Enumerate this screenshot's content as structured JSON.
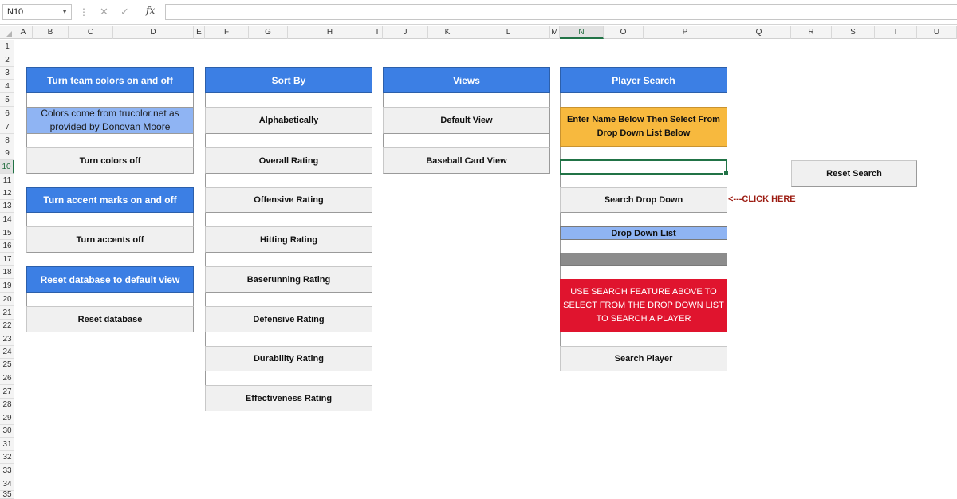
{
  "formula_bar": {
    "name_box": "N10",
    "cancel_icon": "cancel-x-icon",
    "enter_icon": "checkmark-icon",
    "fx_label": "fx",
    "formula": ""
  },
  "columns": [
    "A",
    "B",
    "C",
    "D",
    "E",
    "F",
    "G",
    "H",
    "I",
    "J",
    "K",
    "L",
    "M",
    "N",
    "O",
    "P",
    "Q",
    "R",
    "S",
    "T",
    "U"
  ],
  "selected_column": "N",
  "rows": [
    "1",
    "2",
    "3",
    "4",
    "5",
    "6",
    "7",
    "8",
    "9",
    "10",
    "11",
    "12",
    "13",
    "14",
    "15",
    "16",
    "17",
    "18",
    "19",
    "20",
    "21",
    "22",
    "23",
    "24",
    "25",
    "26",
    "27",
    "28",
    "29",
    "30",
    "31",
    "32",
    "33",
    "34",
    "35"
  ],
  "selected_row": "10",
  "panels": {
    "team_colors": {
      "header": "Turn team colors on and off",
      "note": "Colors come from trucolor.net as provided by Donovan Moore",
      "button": "Turn colors off"
    },
    "accents": {
      "header": "Turn accent marks on and off",
      "button": "Turn accents off"
    },
    "reset_db": {
      "header": "Reset database to default view",
      "button": "Reset database"
    },
    "sort_by": {
      "header": "Sort By",
      "buttons": [
        "Alphabetically",
        "Overall Rating",
        "Offensive Rating",
        "Hitting Rating",
        "Baserunning Rating",
        "Defensive Rating",
        "Durability Rating",
        "Effectiveness Rating"
      ]
    },
    "views": {
      "header": "Views",
      "buttons": [
        "Default View",
        "Baseball Card View"
      ]
    },
    "player_search": {
      "header": "Player Search",
      "instruction": "Enter Name Below Then Select From Drop Down List Below",
      "search_input_value": "",
      "search_dropdown_button": "Search Drop Down",
      "click_here": "<---CLICK HERE",
      "dropdown_list_label": "Drop Down List",
      "warning": "USE SEARCH FEATURE ABOVE TO SELECT FROM THE DROP DOWN LIST TO SEARCH A PLAYER",
      "search_player_button": "Search Player"
    },
    "reset_search": {
      "button": "Reset Search"
    }
  },
  "colors": {
    "header_blue": "#3c7fe4",
    "light_blue": "#8fb4f3",
    "yellow": "#f7b93e",
    "red": "#e0142e",
    "button_grey": "#f0f0f0",
    "selection_green": "#217346"
  }
}
